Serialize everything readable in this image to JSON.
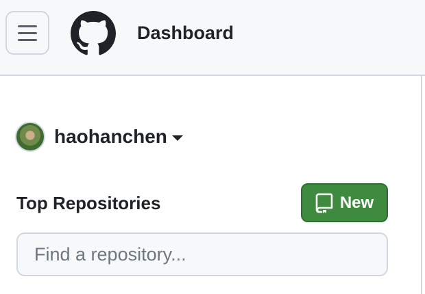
{
  "header": {
    "menu_icon": "hamburger-menu-icon",
    "logo_icon": "github-octocat-icon",
    "title": "Dashboard"
  },
  "account": {
    "username": "haohanchen",
    "caret_icon": "caret-down-icon"
  },
  "repositories": {
    "heading": "Top Repositories",
    "new_button_label": "New",
    "new_button_icon": "repo-icon",
    "new_button_color": "#3e8a3f",
    "search_placeholder": "Find a repository..."
  }
}
